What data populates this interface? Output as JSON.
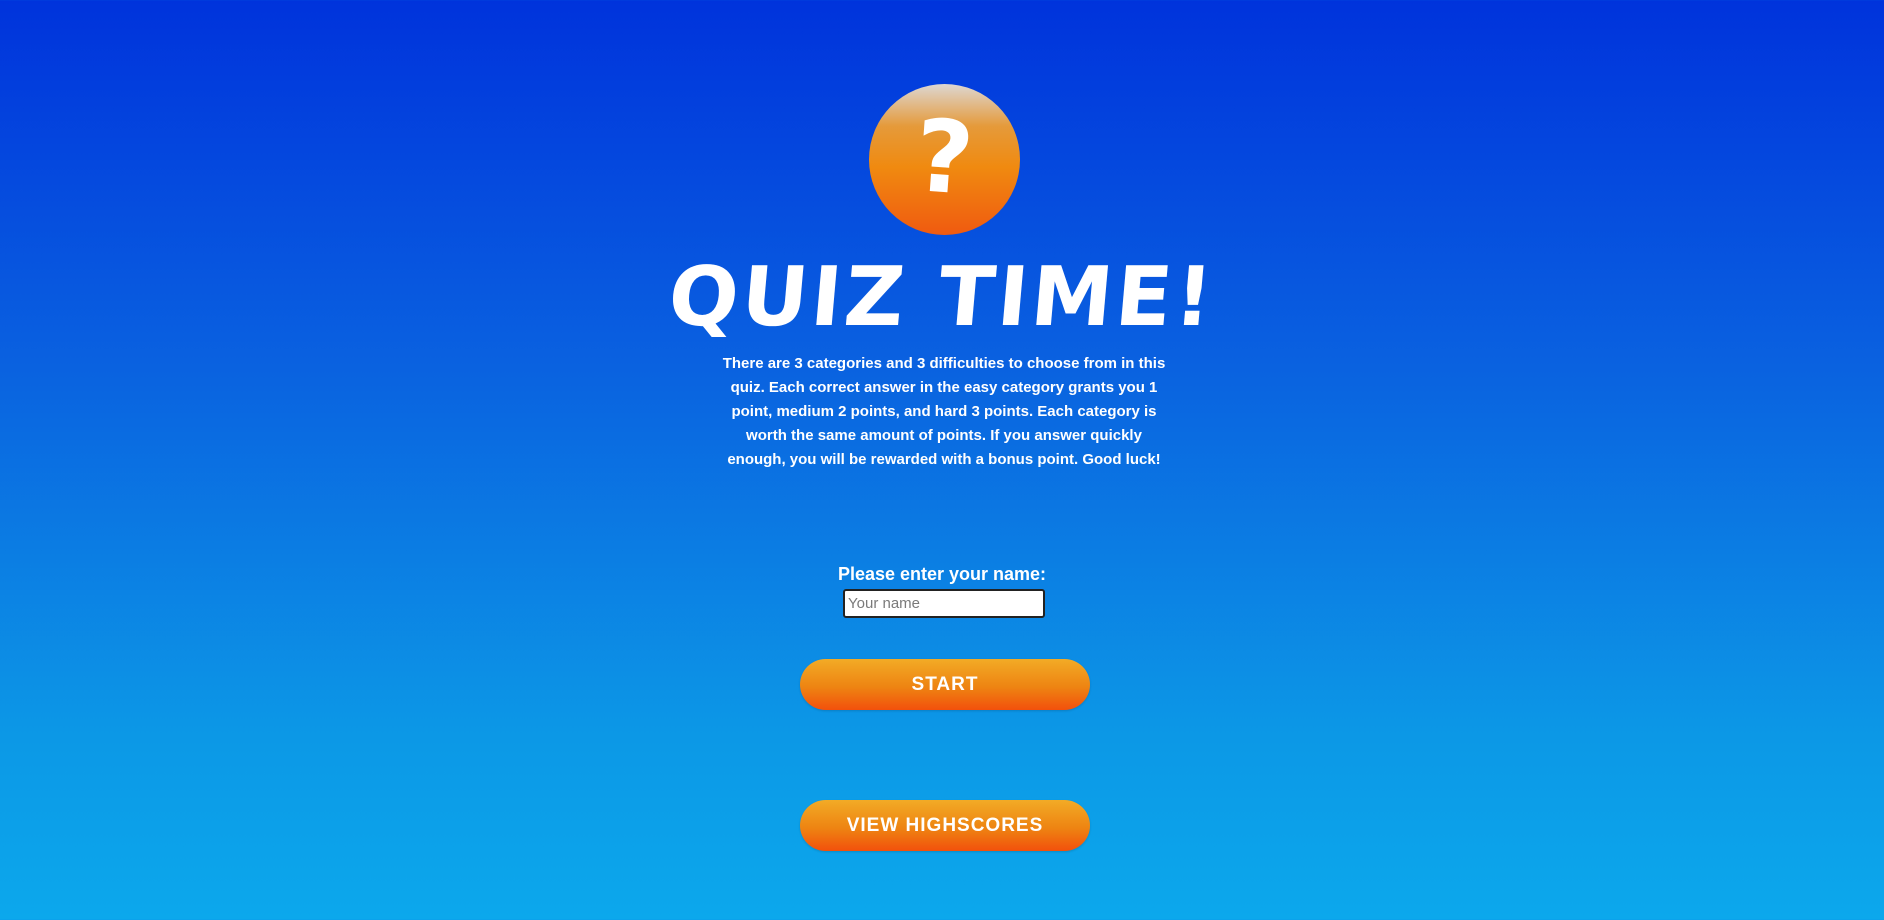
{
  "logo": {
    "symbol": "?",
    "icon": "question-mark-icon"
  },
  "title": "QUIZ TIME!",
  "intro": "There are 3 categories and 3 difficulties to choose from in this quiz. Each correct answer in the easy category grants you 1 point, medium 2 points, and hard 3 points. Each category is worth the same amount of points. If you answer quickly enough, you will be rewarded with a bonus point. Good luck!",
  "name_form": {
    "label": "Please enter your name:",
    "placeholder": "Your name",
    "value": ""
  },
  "buttons": {
    "start": "START",
    "highscores": "VIEW HIGHSCORES"
  },
  "colors": {
    "background_top": "#0033dc",
    "background_bottom": "#0ca8ec",
    "accent_orange": "#ee8412",
    "accent_red": "#f2500c",
    "text": "#ffffff"
  }
}
